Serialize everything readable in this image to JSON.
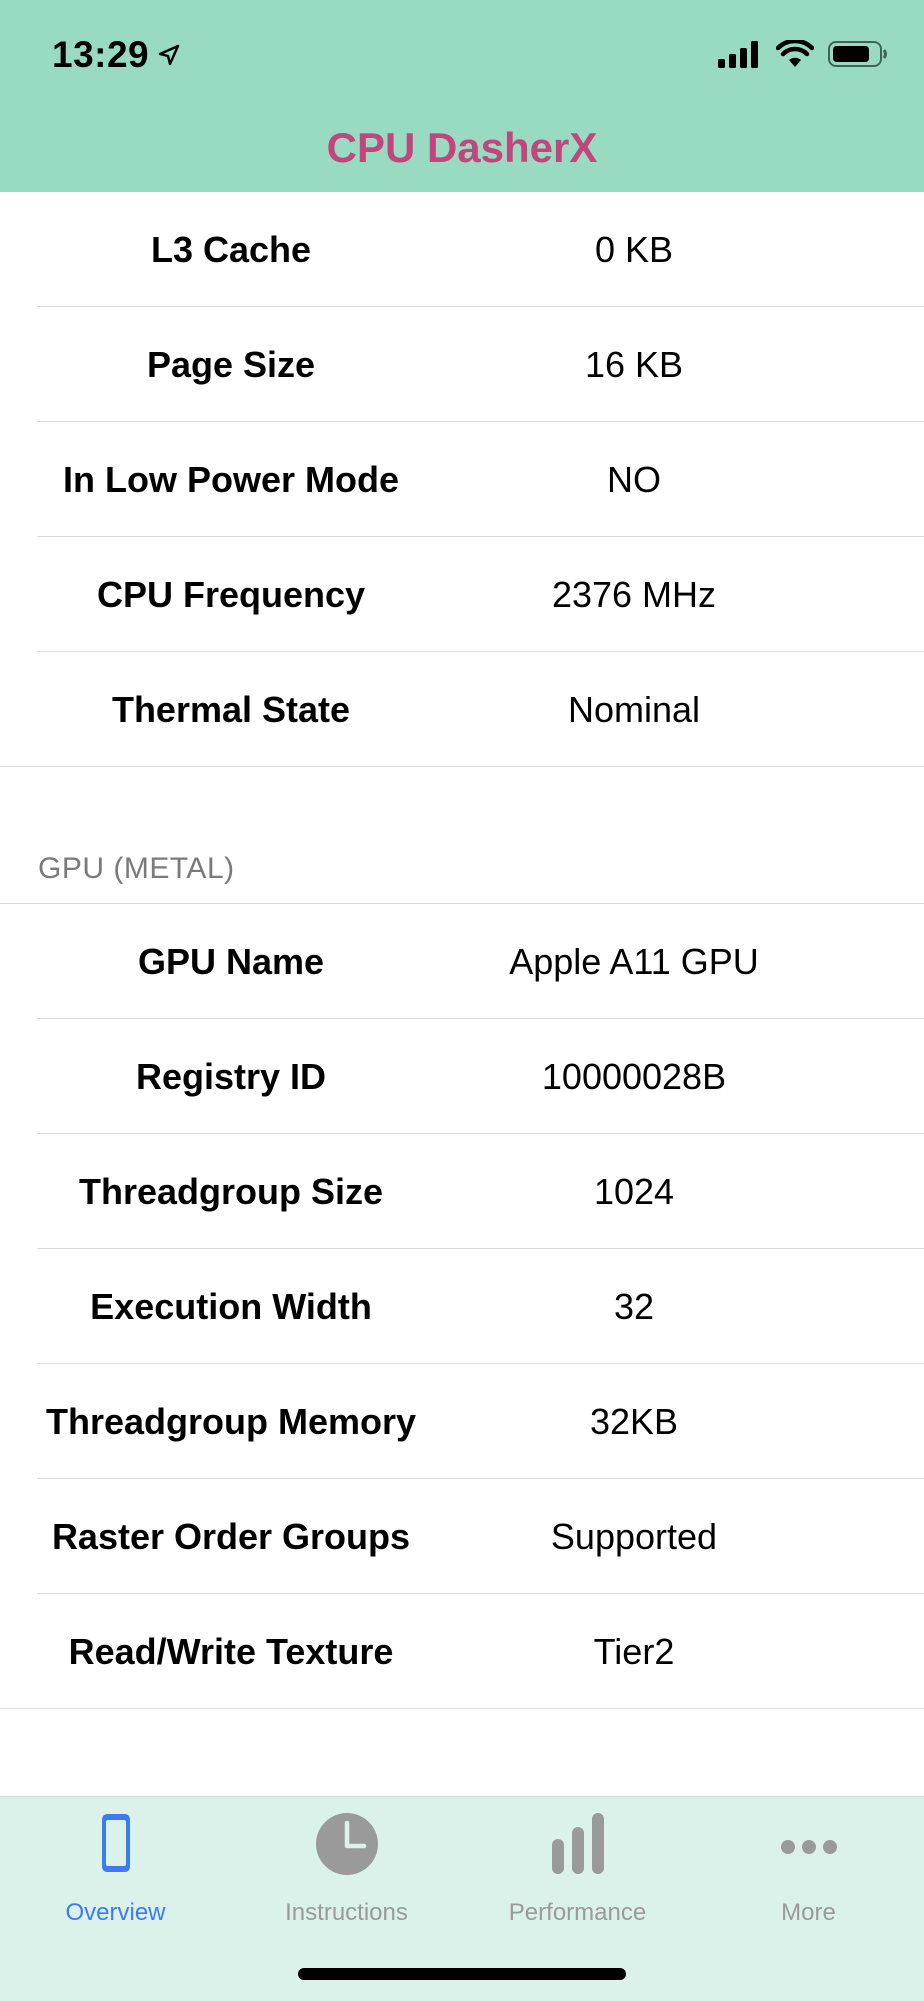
{
  "status_bar": {
    "time": "13:29"
  },
  "app": {
    "title": "CPU DasherX",
    "title_color": "#c2457c",
    "header_color": "#98dbc2"
  },
  "cpu_rows": [
    {
      "label": "L3 Cache",
      "value": "0 KB"
    },
    {
      "label": "Page Size",
      "value": "16 KB"
    },
    {
      "label": "In Low Power Mode",
      "value": "NO"
    },
    {
      "label": "CPU Frequency",
      "value": "2376 MHz"
    },
    {
      "label": "Thermal State",
      "value": "Nominal"
    }
  ],
  "gpu_section": {
    "header": "GPU (METAL)",
    "rows": [
      {
        "label": "GPU Name",
        "value": "Apple A11 GPU"
      },
      {
        "label": "Registry ID",
        "value": "10000028B"
      },
      {
        "label": "Threadgroup Size",
        "value": "1024"
      },
      {
        "label": "Execution Width",
        "value": "32"
      },
      {
        "label": "Threadgroup Memory",
        "value": "32KB"
      },
      {
        "label": "Raster Order Groups",
        "value": "Supported"
      },
      {
        "label": "Read/Write Texture",
        "value": "Tier2"
      }
    ]
  },
  "tabbar": {
    "active_color": "#3d7cf0",
    "inactive_color": "#9a9a9a",
    "tabs": [
      {
        "label": "Overview",
        "icon": "phone-icon",
        "active": true
      },
      {
        "label": "Instructions",
        "icon": "clock-icon",
        "active": false
      },
      {
        "label": "Performance",
        "icon": "bar-chart-icon",
        "active": false
      },
      {
        "label": "More",
        "icon": "more-dots-icon",
        "active": false
      }
    ]
  }
}
